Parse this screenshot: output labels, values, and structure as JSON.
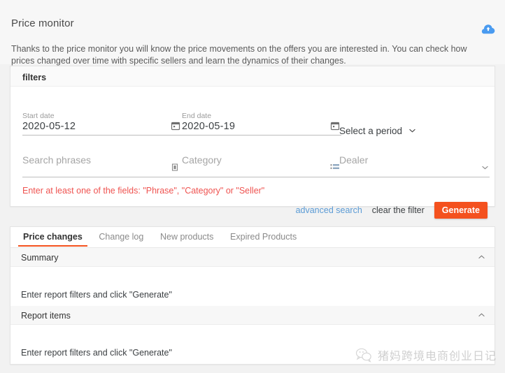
{
  "header": {
    "title": "Price monitor",
    "intro": "Thanks to the price monitor you will know the price movements on the offers you are interested in. You can check how prices changed over time with specific sellers and learn the dynamics of their changes.",
    "cloud_icon": "cloud-upload-icon",
    "accent_color": "#4a9bf0"
  },
  "filters": {
    "panel_label": "filters",
    "start_date": {
      "label": "Start date",
      "value": "2020-05-12",
      "icon": "calendar-icon"
    },
    "end_date": {
      "label": "End date",
      "value": "2020-05-19",
      "icon": "calendar-icon"
    },
    "period": {
      "label": "Select a period",
      "icon": "chevron-down-icon"
    },
    "search_phrases": {
      "placeholder": "Search phrases",
      "value": "",
      "icon": "text-field-icon"
    },
    "category": {
      "placeholder": "Category",
      "value": "",
      "icon": "list-icon"
    },
    "dealer": {
      "placeholder": "Dealer",
      "value": "",
      "icon": "chevron-down-icon"
    },
    "error": "Enter at least one of the fields: \"Phrase\", \"Category\" or \"Seller\"",
    "error_color": "#ef5350",
    "advanced_search": "advanced search",
    "advanced_search_color": "#5b9bd5",
    "clear_filter": "clear the filter",
    "generate": "Generate",
    "generate_color": "#f4511e"
  },
  "results": {
    "tabs": [
      {
        "label": "Price changes",
        "active": true
      },
      {
        "label": "Change log",
        "active": false
      },
      {
        "label": "New products",
        "active": false
      },
      {
        "label": "Expired Products",
        "active": false
      }
    ],
    "sections": [
      {
        "title": "Summary",
        "chevron": "chevron-up-icon",
        "body": "Enter report filters and click \"Generate\""
      },
      {
        "title": "Report items",
        "chevron": "chevron-up-icon",
        "body": "Enter report filters and click \"Generate\""
      }
    ]
  },
  "watermark": {
    "icon": "wechat-icon",
    "text": "猪妈跨境电商创业日记"
  }
}
